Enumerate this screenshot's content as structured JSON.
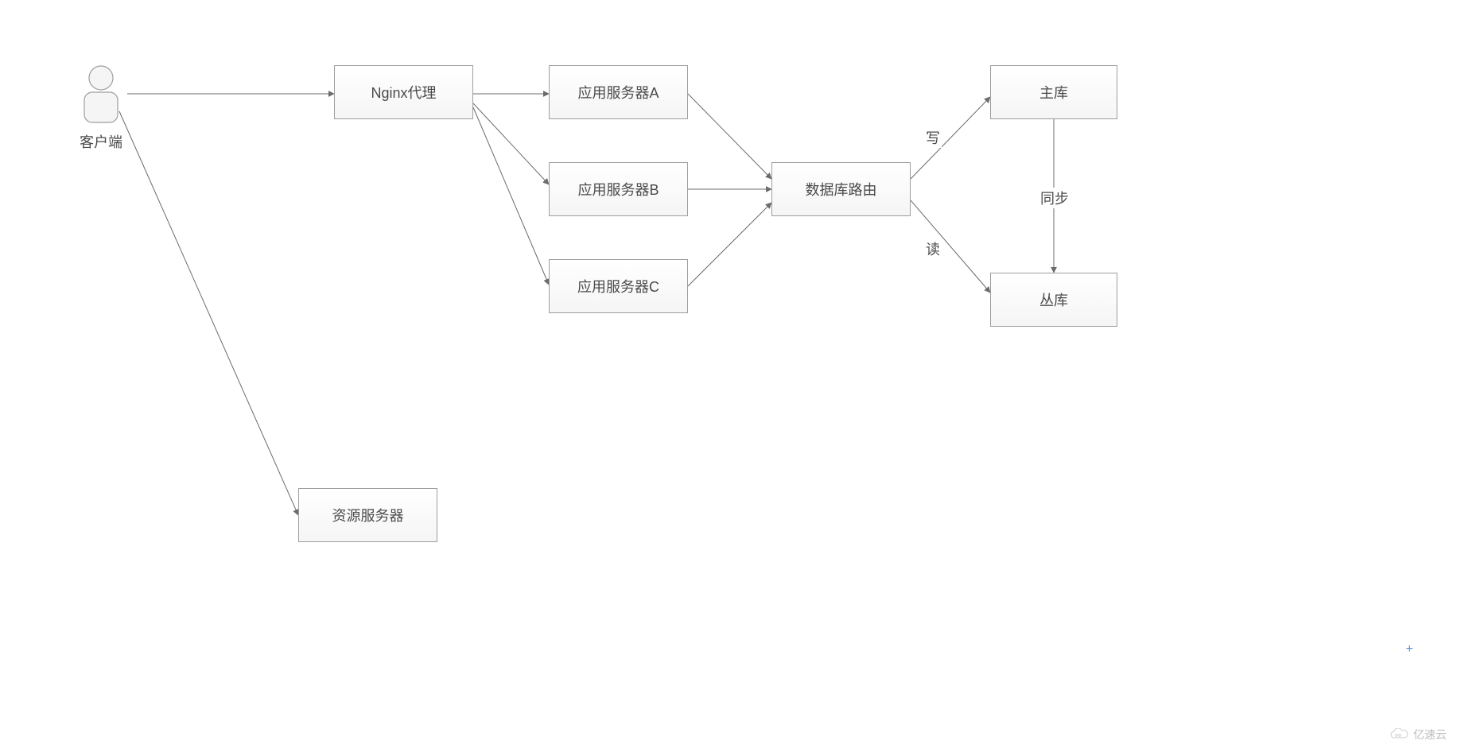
{
  "nodes": {
    "client_label": "客户端",
    "nginx": "Nginx代理",
    "app_a": "应用服务器A",
    "app_b": "应用服务器B",
    "app_c": "应用服务器C",
    "db_router": "数据库路由",
    "master_db": "主库",
    "slave_db": "丛库",
    "resource_server": "资源服务器"
  },
  "edge_labels": {
    "write": "写",
    "read": "读",
    "sync": "同步"
  },
  "watermark": "亿速云"
}
